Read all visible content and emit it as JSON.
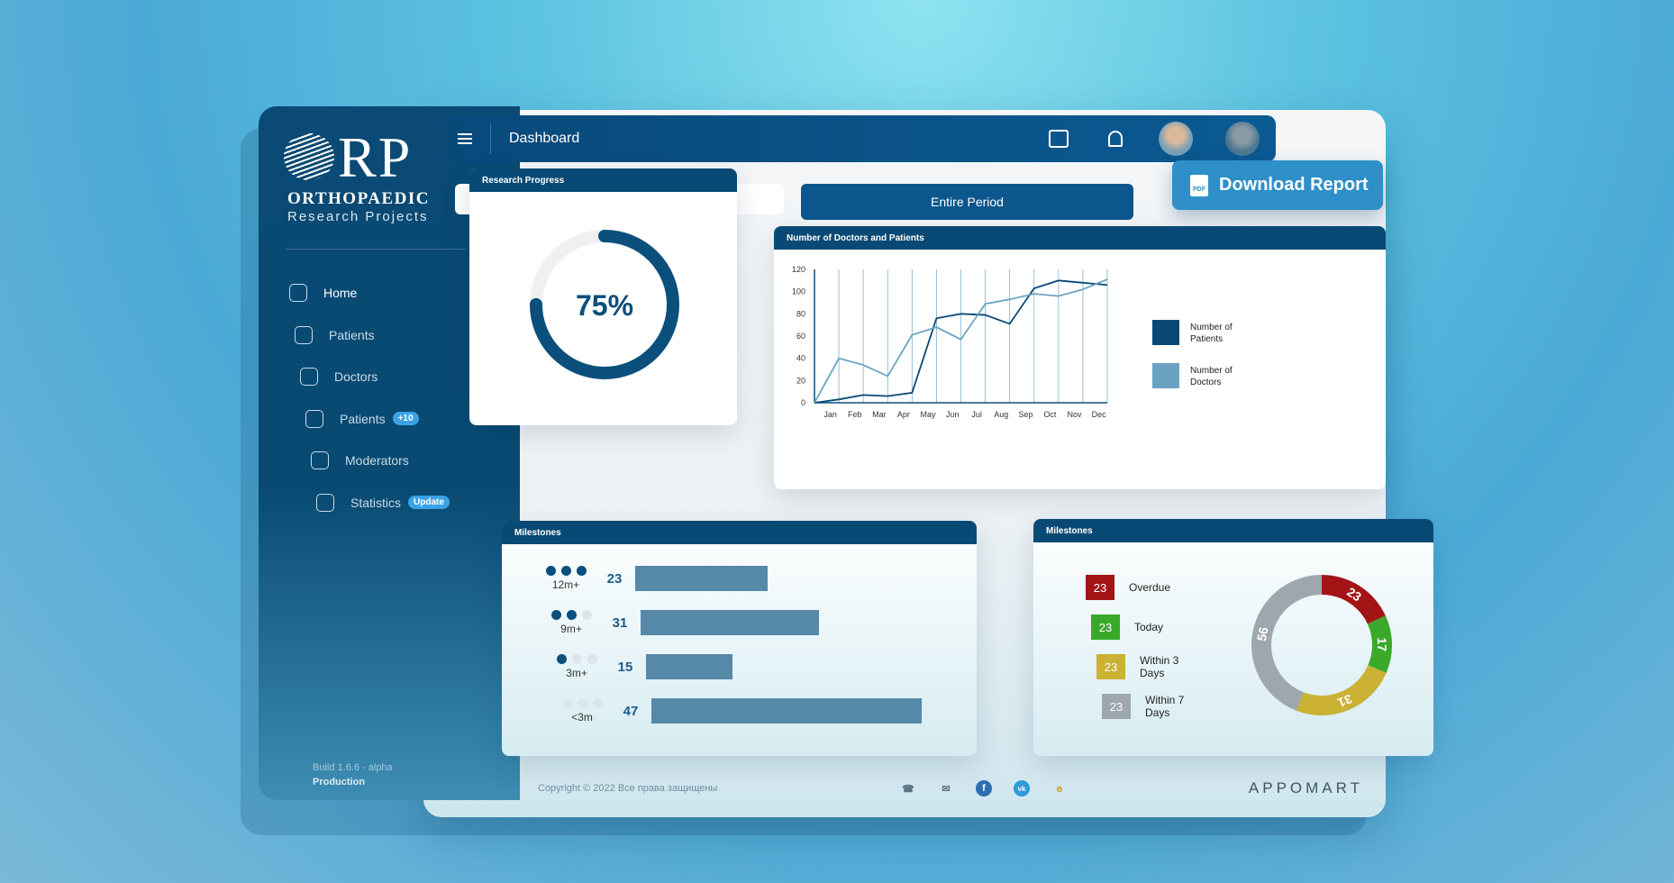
{
  "brand": {
    "logo": "RP",
    "title": "ORTHOPAEDIC",
    "subtitle": "Research Projects"
  },
  "sidebar": {
    "items": [
      {
        "label": "Home",
        "icon": "home-icon"
      },
      {
        "label": "Patients",
        "icon": "patient-icon"
      },
      {
        "label": "Doctors",
        "icon": "doctors-icon"
      },
      {
        "label": "Patients",
        "icon": "group-icon",
        "badge": "+10"
      },
      {
        "label": "Moderators",
        "icon": "shield-icon"
      },
      {
        "label": "Statistics",
        "icon": "chart-icon",
        "badge": "Update"
      }
    ],
    "build": "Build 1.6.6 - alpha",
    "env": "Production"
  },
  "header": {
    "title": "Dashboard"
  },
  "filter": {
    "period": "Entire Period"
  },
  "download": {
    "label": "Download Report",
    "icon_text": "PDF"
  },
  "progress": {
    "title": "Research Progress",
    "value": 75,
    "label": "75%"
  },
  "chart_data": [
    {
      "type": "line",
      "title": "Number of Doctors and Patients",
      "categories": [
        "Jan",
        "Feb",
        "Mar",
        "Apr",
        "May",
        "Jun",
        "Jul",
        "Aug",
        "Sep",
        "Oct",
        "Nov",
        "Dec"
      ],
      "yticks": [
        0,
        20,
        40,
        60,
        80,
        100,
        120
      ],
      "ylim": [
        0,
        120
      ],
      "grid": "vertical",
      "legend": "right",
      "series": [
        {
          "name": "Number of Patients",
          "color": "#084a75",
          "values": [
            0,
            3,
            7,
            6,
            9,
            76,
            80,
            79,
            71,
            103,
            110,
            108,
            106
          ]
        },
        {
          "name": "Number of Doctors",
          "color": "#6aa3c2",
          "values": [
            0,
            40,
            34,
            24,
            61,
            68,
            57,
            89,
            93,
            98,
            96,
            102,
            111
          ]
        }
      ]
    },
    {
      "type": "bar",
      "title": "Milestones",
      "orientation": "horizontal",
      "categories": [
        "12m+",
        "9m+",
        "3m+",
        "<3m"
      ],
      "values": [
        23,
        31,
        15,
        47
      ],
      "dots_filled": [
        3,
        2,
        1,
        0
      ]
    },
    {
      "type": "pie",
      "title": "Milestones",
      "donut": true,
      "legend": [
        {
          "value": "23",
          "label": "Overdue",
          "color": "#a31416"
        },
        {
          "value": "23",
          "label": "Today",
          "color": "#3aa92a"
        },
        {
          "value": "23",
          "label": "Within 3 Days",
          "color": "#cbb134"
        },
        {
          "value": "23",
          "label": "Within 7 Days",
          "color": "#9ea7ad"
        }
      ],
      "slices": [
        {
          "label": "Overdue",
          "value": 23,
          "color": "#a31416"
        },
        {
          "label": "Today",
          "value": 17,
          "color": "#3aa92a"
        },
        {
          "label": "Within 3 Days",
          "value": 31,
          "color": "#cbb134"
        },
        {
          "label": "Within 7 Days",
          "value": 56,
          "color": "#9ea7ad"
        }
      ]
    }
  ],
  "footer": {
    "copyright": "Copyright © 2022 Все права защищены",
    "vendor": "APPOMART",
    "icons": [
      "phone-icon",
      "mail-icon",
      "facebook-icon",
      "vk-icon",
      "ok-icon"
    ]
  }
}
